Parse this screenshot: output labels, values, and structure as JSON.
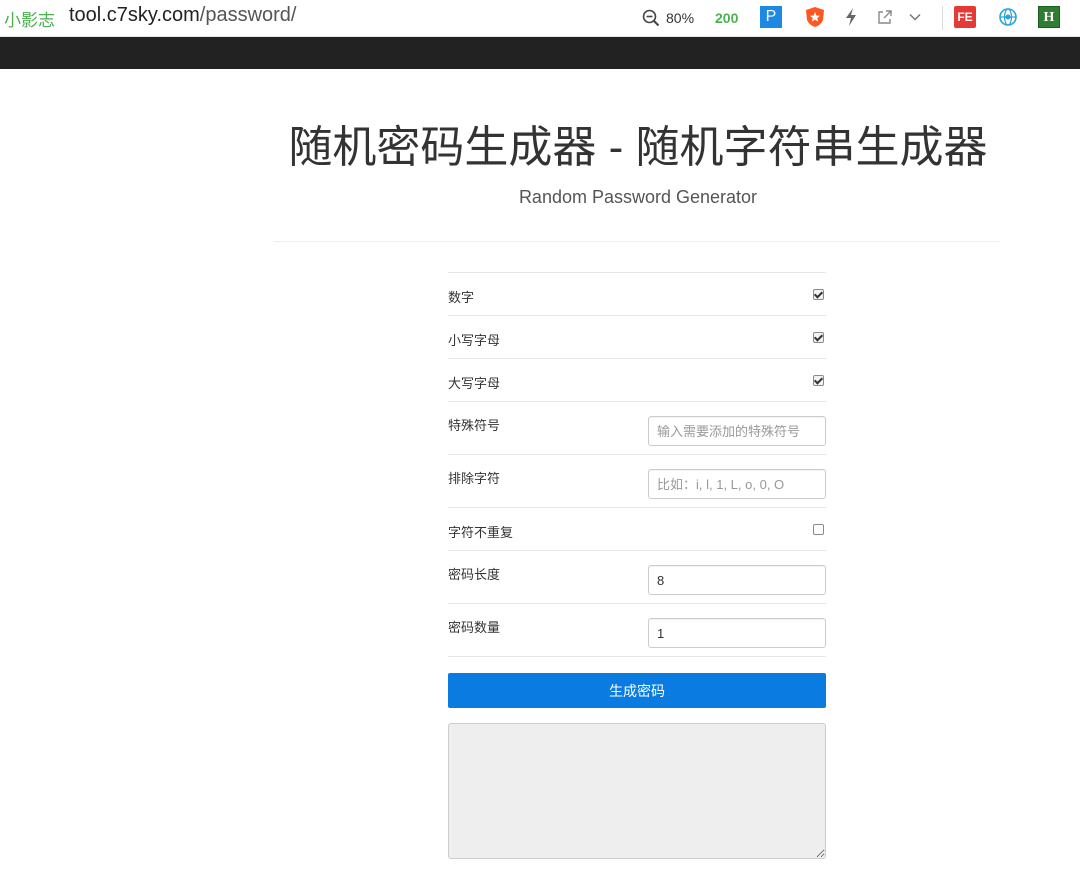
{
  "browser": {
    "site_brand": "小影志",
    "url_host": "tool.c7sky.com",
    "url_path": "/password/",
    "zoom": "80%",
    "badge": "200",
    "extensions": {
      "p_label": "P",
      "fe_label": "FE",
      "h_label": "H"
    },
    "icons": [
      "zoom-icon",
      "p-extension-icon",
      "shield-extension-icon",
      "bolt-icon",
      "share-icon",
      "chevron-down-icon",
      "fe-extension-icon",
      "globe-extension-icon",
      "h-extension-icon"
    ]
  },
  "header": {
    "title": "随机密码生成器 - 随机字符串生成器",
    "subtitle": "Random Password Generator"
  },
  "options": {
    "digits": {
      "label": "数字",
      "checked": true
    },
    "lowercase": {
      "label": "小写字母",
      "checked": true
    },
    "uppercase": {
      "label": "大写字母",
      "checked": true
    },
    "special": {
      "label": "特殊符号",
      "placeholder": "输入需要添加的特殊符号",
      "value": ""
    },
    "exclude": {
      "label": "排除字符",
      "placeholder": "比如：i, l, 1, L, o, 0, O",
      "value": ""
    },
    "no_repeat": {
      "label": "字符不重复",
      "checked": false
    },
    "length": {
      "label": "密码长度",
      "value": "8"
    },
    "count": {
      "label": "密码数量",
      "value": "1"
    }
  },
  "actions": {
    "generate_label": "生成密码"
  },
  "output": {
    "value": ""
  },
  "colors": {
    "navbar": "#222222",
    "primary_button": "#0a7be0",
    "brand_green": "#4caf50"
  }
}
